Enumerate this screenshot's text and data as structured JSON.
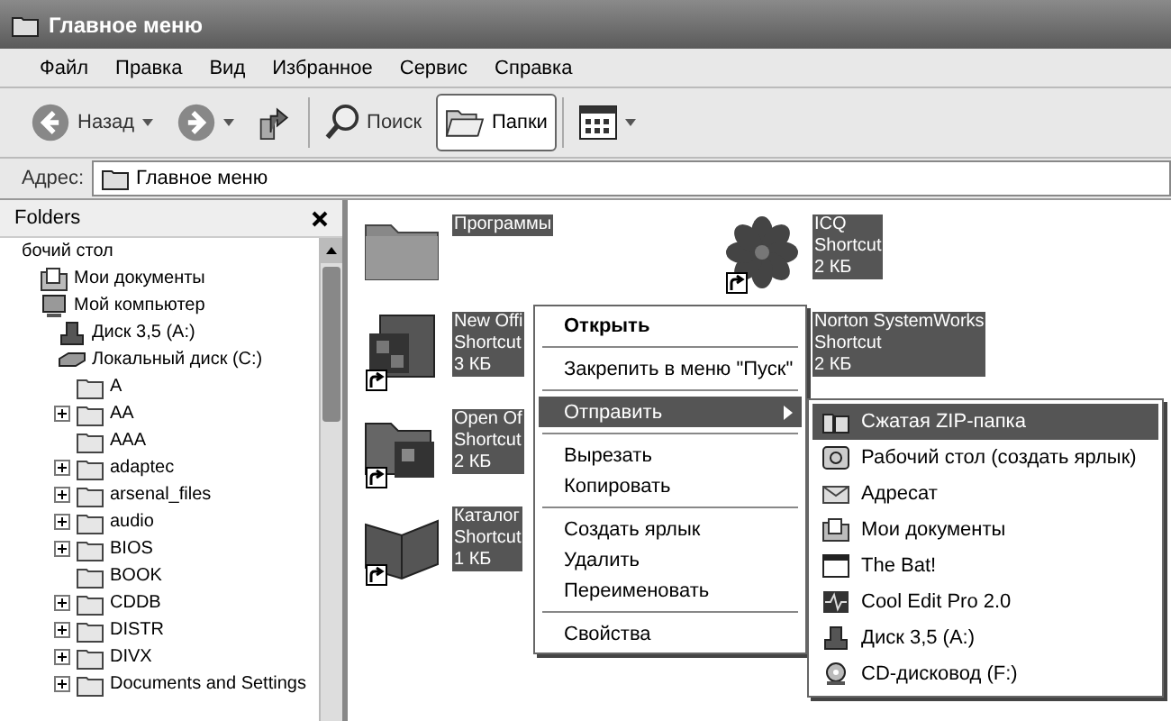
{
  "window": {
    "title": "Главное меню"
  },
  "menu_bar": [
    "Файл",
    "Правка",
    "Вид",
    "Избранное",
    "Сервис",
    "Справка"
  ],
  "toolbar": [
    {
      "kind": "back",
      "label": "Назад",
      "selected": false
    },
    {
      "kind": "forward",
      "selected": false
    },
    {
      "kind": "up",
      "selected": false
    },
    {
      "kind": "search",
      "label": "Поиск",
      "selected": false
    },
    {
      "kind": "folders",
      "label": "Папки",
      "selected": true
    },
    {
      "kind": "views",
      "selected": false
    }
  ],
  "address_bar": {
    "label": "Адрес:",
    "value": "Главное меню"
  },
  "folders_pane": {
    "title": "Folders",
    "tree": [
      {
        "label": "бочий стол",
        "expander": false,
        "children": [
          {
            "label": "Мои документы",
            "kind": "documents",
            "expander": false
          },
          {
            "label": "Мой компьютер",
            "kind": "computer",
            "expander": false,
            "children": [
              {
                "label": "Диск 3,5 (A:)",
                "kind": "floppy",
                "expander": false
              },
              {
                "label": "Локальный диск (C:)",
                "kind": "disk",
                "expander": false,
                "children": [
                  {
                    "label": "A",
                    "kind": "folder",
                    "expander": false
                  },
                  {
                    "label": "AA",
                    "kind": "folder",
                    "expander": true
                  },
                  {
                    "label": "AAA",
                    "kind": "folder",
                    "expander": false
                  },
                  {
                    "label": "adaptec",
                    "kind": "folder",
                    "expander": true
                  },
                  {
                    "label": "arsenal_files",
                    "kind": "folder",
                    "expander": true
                  },
                  {
                    "label": "audio",
                    "kind": "folder",
                    "expander": true
                  },
                  {
                    "label": "BIOS",
                    "kind": "folder",
                    "expander": true
                  },
                  {
                    "label": "BOOK",
                    "kind": "folder",
                    "expander": false
                  },
                  {
                    "label": "CDDB",
                    "kind": "folder",
                    "expander": true
                  },
                  {
                    "label": "DISTR",
                    "kind": "folder",
                    "expander": true
                  },
                  {
                    "label": "DIVX",
                    "kind": "folder",
                    "expander": true
                  },
                  {
                    "label": "Documents and Settings",
                    "kind": "folder",
                    "expander": true
                  }
                ]
              }
            ]
          }
        ]
      }
    ]
  },
  "files": [
    {
      "kind": "folder",
      "lines": [
        "Программы"
      ],
      "selected": true
    },
    {
      "kind": "app",
      "lines": [
        "New Offi",
        "Shortcut",
        "3 КБ"
      ],
      "selected": true
    },
    {
      "kind": "appfolder",
      "lines": [
        "Open Of",
        "Shortcut",
        "2 КБ"
      ],
      "selected": true
    },
    {
      "kind": "book",
      "lines": [
        "Каталог",
        "Shortcut",
        "1 КБ"
      ],
      "selected": true
    },
    {
      "kind": "flower",
      "lines": [
        "ICQ",
        "Shortcut",
        "2 КБ"
      ],
      "selected": true
    },
    {
      "kind": "app",
      "lines": [
        "Norton SystemWorks",
        "Shortcut",
        "2 КБ"
      ],
      "selected": true
    }
  ],
  "context_menu": {
    "items": [
      {
        "kind": "item",
        "label": "Открыть",
        "default": true,
        "selected": false,
        "submenu": false
      },
      {
        "kind": "separator"
      },
      {
        "kind": "item",
        "label": "Закрепить в меню \"Пуск\"",
        "default": false,
        "selected": false,
        "submenu": false
      },
      {
        "kind": "separator"
      },
      {
        "kind": "item",
        "label": "Отправить",
        "default": false,
        "selected": true,
        "submenu": true
      },
      {
        "kind": "separator"
      },
      {
        "kind": "item",
        "label": "Вырезать",
        "default": false,
        "selected": false,
        "submenu": false
      },
      {
        "kind": "item",
        "label": "Копировать",
        "default": false,
        "selected": false,
        "submenu": false
      },
      {
        "kind": "separator"
      },
      {
        "kind": "item",
        "label": "Создать ярлык",
        "default": false,
        "selected": false,
        "submenu": false
      },
      {
        "kind": "item",
        "label": "Удалить",
        "default": false,
        "selected": false,
        "submenu": false
      },
      {
        "kind": "item",
        "label": "Переименовать",
        "default": false,
        "selected": false,
        "submenu": false
      },
      {
        "kind": "separator"
      },
      {
        "kind": "item",
        "label": "Свойства",
        "default": false,
        "selected": false,
        "submenu": false
      }
    ]
  },
  "submenu": {
    "items": [
      {
        "kind": "zip",
        "label": "Сжатая ZIP-папка",
        "selected": true
      },
      {
        "kind": "desktop",
        "label": "Рабочий стол (создать ярлык)",
        "selected": false
      },
      {
        "kind": "mail",
        "label": "Адресат",
        "selected": false
      },
      {
        "kind": "documents",
        "label": "Мои документы",
        "selected": false
      },
      {
        "kind": "window",
        "label": "The Bat!",
        "selected": false
      },
      {
        "kind": "wave",
        "label": "Cool Edit Pro 2.0",
        "selected": false
      },
      {
        "kind": "floppy",
        "label": "Диск 3,5 (A:)",
        "selected": false
      },
      {
        "kind": "cd",
        "label": "CD-дисковод (F:)",
        "selected": false
      }
    ]
  }
}
